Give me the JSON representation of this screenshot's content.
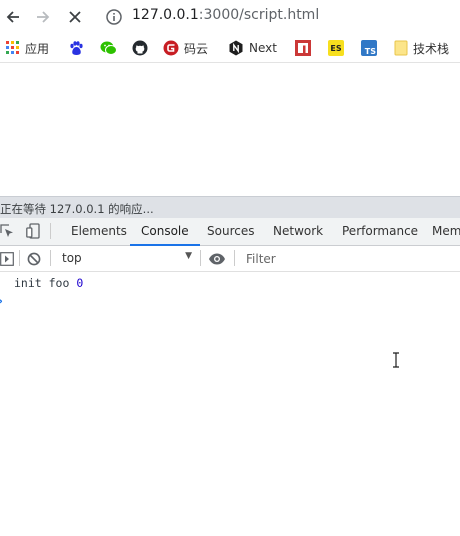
{
  "browser": {
    "url_host": "127.0.0.1",
    "url_rest": ":3000/script.html"
  },
  "bookmarks": [
    {
      "label": "应用",
      "icon": "apps-grid-icon"
    },
    {
      "label": "",
      "icon": "baidu-paw-icon"
    },
    {
      "label": "",
      "icon": "wechat-icon"
    },
    {
      "label": "",
      "icon": "github-icon"
    },
    {
      "label": "码云",
      "icon": "gitee-icon"
    },
    {
      "label": "Next",
      "icon": "nextjs-icon"
    },
    {
      "label": "",
      "icon": "npm-icon"
    },
    {
      "label": "",
      "icon": "es-icon",
      "badge": "ES",
      "color": "#f7df1e"
    },
    {
      "label": "",
      "icon": "ts-icon",
      "badge": "TS",
      "color": "#3178c6"
    },
    {
      "label": "技术栈",
      "icon": "folder-icon"
    }
  ],
  "status": {
    "text": "正在等待 127.0.0.1 的响应..."
  },
  "devtools": {
    "tabs": [
      {
        "label": "Elements"
      },
      {
        "label": "Console"
      },
      {
        "label": "Sources"
      },
      {
        "label": "Network"
      },
      {
        "label": "Performance"
      },
      {
        "label": "Memo"
      }
    ],
    "active_tab": "Console",
    "context": "top",
    "filter_placeholder": "Filter",
    "log": {
      "text": "init foo ",
      "number": "0"
    }
  },
  "colors": {
    "accent": "#1a73e8",
    "gitee": "#c71d23",
    "npm": "#cb3837",
    "wechat": "#2dc100",
    "baidu": "#2932e1"
  }
}
